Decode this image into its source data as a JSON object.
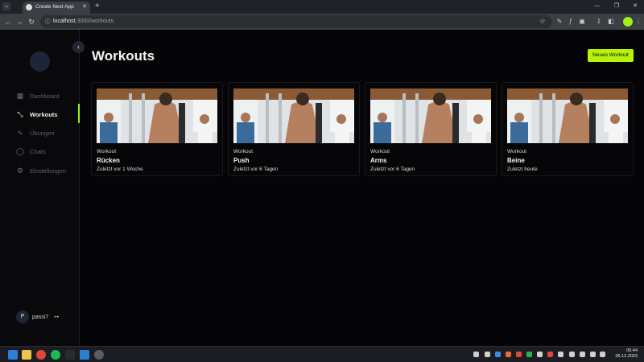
{
  "browser": {
    "tab_title": "Create Next App",
    "url_host": "localhost",
    "url_path": ":3000/workouts"
  },
  "sidebar": {
    "items": [
      {
        "label": "Dashboard",
        "icon": "dashboard-icon"
      },
      {
        "label": "Workouts",
        "icon": "dumbbell-icon",
        "active": true
      },
      {
        "label": "Übungen",
        "icon": "activity-icon"
      },
      {
        "label": "Chats",
        "icon": "chat-icon"
      },
      {
        "label": "Einstellungen",
        "icon": "gear-icon"
      }
    ],
    "user": {
      "initial": "P",
      "name": "passi7"
    }
  },
  "main": {
    "title": "Workouts",
    "new_button": "Neues Workout",
    "cards": [
      {
        "type": "Workout",
        "name": "Rücken",
        "last": "Zuletzt vor 1 Woche"
      },
      {
        "type": "Workout",
        "name": "Push",
        "last": "Zuletzt vor 6 Tagen"
      },
      {
        "type": "Workout",
        "name": "Arms",
        "last": "Zuletzt vor 6 Tagen"
      },
      {
        "type": "Workout",
        "name": "Beine",
        "last": "Zuletzt heute"
      }
    ]
  },
  "taskbar": {
    "time": "06:44",
    "date": "06.12.2023"
  },
  "colors": {
    "accent": "#b7f20a",
    "background": "#050508"
  }
}
